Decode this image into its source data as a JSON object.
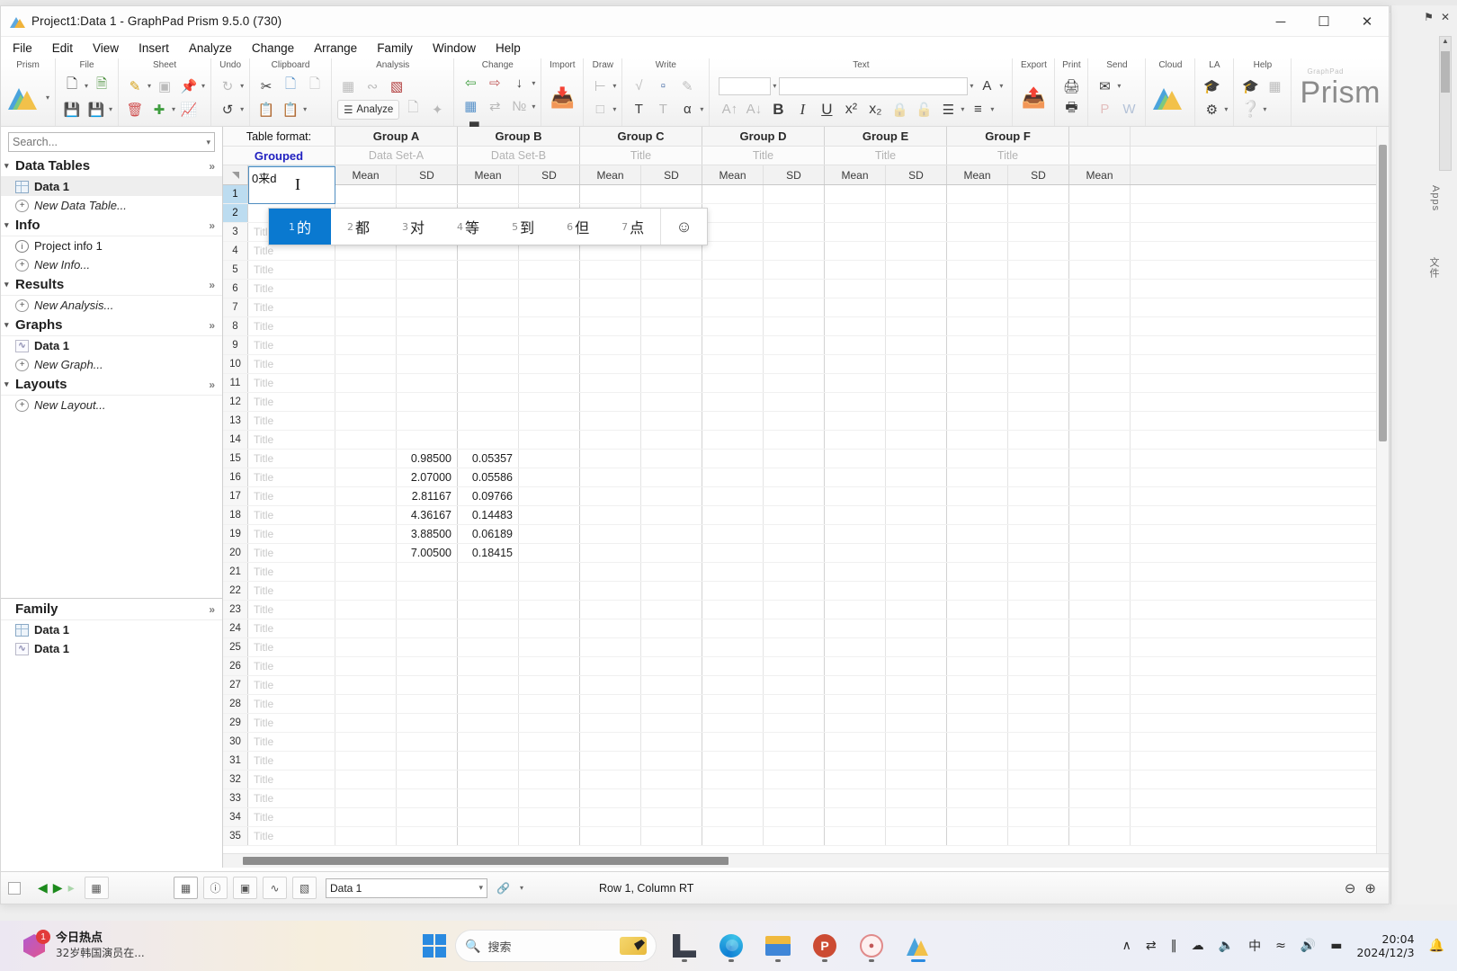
{
  "window": {
    "title": "Project1:Data 1 - GraphPad Prism 9.5.0 (730)",
    "minimize": "─",
    "maximize": "☐",
    "close": "✕"
  },
  "menu": {
    "items": [
      "File",
      "Edit",
      "View",
      "Insert",
      "Analyze",
      "Change",
      "Arrange",
      "Family",
      "Window",
      "Help"
    ]
  },
  "ribbon": {
    "groups": [
      {
        "label": "Prism"
      },
      {
        "label": "File"
      },
      {
        "label": "Sheet"
      },
      {
        "label": "Undo"
      },
      {
        "label": "Clipboard"
      },
      {
        "label": "Analysis"
      },
      {
        "label": "Change"
      },
      {
        "label": "Import"
      },
      {
        "label": "Draw"
      },
      {
        "label": "Write"
      },
      {
        "label": "Text"
      },
      {
        "label": "Export"
      },
      {
        "label": "Print"
      },
      {
        "label": "Send"
      },
      {
        "label": "Cloud"
      },
      {
        "label": "LA"
      },
      {
        "label": "Help"
      }
    ],
    "analyze_label": "Analyze",
    "font_size_value": "",
    "font_name_value": "",
    "brand": "Prism",
    "brand_tiny": "GraphPad"
  },
  "navigator": {
    "search_placeholder": "Search...",
    "sections": [
      {
        "title": "Data Tables",
        "expand": "»",
        "items": [
          {
            "label": "Data 1",
            "icon": "table-icon",
            "style": "bold",
            "selected": true
          },
          {
            "label": "New Data Table...",
            "icon": "plus-icon",
            "style": "italic",
            "selected": false
          }
        ]
      },
      {
        "title": "Info",
        "expand": "»",
        "items": [
          {
            "label": "Project info 1",
            "icon": "info-icon",
            "style": "normal",
            "selected": false
          },
          {
            "label": "New Info...",
            "icon": "plus-icon",
            "style": "italic",
            "selected": false
          }
        ]
      },
      {
        "title": "Results",
        "expand": "»",
        "items": [
          {
            "label": "New Analysis...",
            "icon": "plus-icon",
            "style": "italic",
            "selected": false
          }
        ]
      },
      {
        "title": "Graphs",
        "expand": "»",
        "items": [
          {
            "label": "Data 1",
            "icon": "graph-icon",
            "style": "bold",
            "selected": false
          },
          {
            "label": "New Graph...",
            "icon": "plus-icon",
            "style": "italic",
            "selected": false
          }
        ]
      },
      {
        "title": "Layouts",
        "expand": "»",
        "items": [
          {
            "label": "New Layout...",
            "icon": "plus-icon",
            "style": "italic",
            "selected": false
          }
        ]
      }
    ],
    "family": {
      "title": "Family",
      "expand": "»",
      "items": [
        {
          "label": "Data 1",
          "icon": "table-icon",
          "style": "bold"
        },
        {
          "label": "Data 1",
          "icon": "graph-icon",
          "style": "bold"
        }
      ]
    }
  },
  "sheet": {
    "format_label": "Table format:",
    "format_value": "Grouped",
    "close_col": "✕",
    "groups": [
      {
        "name": "Group A",
        "subtitle": "Data Set-A"
      },
      {
        "name": "Group B",
        "subtitle": "Data Set-B"
      },
      {
        "name": "Group C",
        "subtitle": "Title"
      },
      {
        "name": "Group D",
        "subtitle": "Title"
      },
      {
        "name": "Group E",
        "subtitle": "Title"
      },
      {
        "name": "Group F",
        "subtitle": "Title"
      }
    ],
    "subcolumns": [
      "Mean",
      "SD"
    ],
    "partial_subcolumn": "Mean",
    "row_title_placeholder": "Title",
    "editing_cell_text": "0来d",
    "rows": [
      {
        "n": "1",
        "title": "",
        "a_mean": "",
        "a_sd": "",
        "b_mean": "",
        "b_sd": ""
      },
      {
        "n": "2",
        "title": "",
        "a_mean": "",
        "a_sd": "",
        "b_mean": "",
        "b_sd": ""
      },
      {
        "n": "3",
        "title": "Title",
        "a_mean": "",
        "a_sd": "",
        "b_mean": "",
        "b_sd": ""
      },
      {
        "n": "4",
        "title": "Title",
        "a_mean": "",
        "a_sd": "",
        "b_mean": "",
        "b_sd": ""
      },
      {
        "n": "5",
        "title": "Title",
        "a_mean": "",
        "a_sd": "",
        "b_mean": "",
        "b_sd": ""
      },
      {
        "n": "6",
        "title": "Title",
        "a_mean": "",
        "a_sd": "",
        "b_mean": "",
        "b_sd": ""
      },
      {
        "n": "7",
        "title": "Title",
        "a_mean": "",
        "a_sd": "",
        "b_mean": "",
        "b_sd": ""
      },
      {
        "n": "8",
        "title": "Title",
        "a_mean": "",
        "a_sd": "",
        "b_mean": "",
        "b_sd": ""
      },
      {
        "n": "9",
        "title": "Title",
        "a_mean": "",
        "a_sd": "",
        "b_mean": "",
        "b_sd": ""
      },
      {
        "n": "10",
        "title": "Title",
        "a_mean": "",
        "a_sd": "",
        "b_mean": "",
        "b_sd": ""
      },
      {
        "n": "11",
        "title": "Title",
        "a_mean": "",
        "a_sd": "",
        "b_mean": "",
        "b_sd": ""
      },
      {
        "n": "12",
        "title": "Title",
        "a_mean": "",
        "a_sd": "",
        "b_mean": "",
        "b_sd": ""
      },
      {
        "n": "13",
        "title": "Title",
        "a_mean": "",
        "a_sd": "",
        "b_mean": "",
        "b_sd": ""
      },
      {
        "n": "14",
        "title": "Title",
        "a_mean": "",
        "a_sd": "",
        "b_mean": "",
        "b_sd": ""
      },
      {
        "n": "15",
        "title": "Title",
        "a_mean": "",
        "a_sd": "0.98500",
        "b_mean": "0.05357",
        "b_sd": ""
      },
      {
        "n": "16",
        "title": "Title",
        "a_mean": "",
        "a_sd": "2.07000",
        "b_mean": "0.05586",
        "b_sd": ""
      },
      {
        "n": "17",
        "title": "Title",
        "a_mean": "",
        "a_sd": "2.81167",
        "b_mean": "0.09766",
        "b_sd": ""
      },
      {
        "n": "18",
        "title": "Title",
        "a_mean": "",
        "a_sd": "4.36167",
        "b_mean": "0.14483",
        "b_sd": ""
      },
      {
        "n": "19",
        "title": "Title",
        "a_mean": "",
        "a_sd": "3.88500",
        "b_mean": "0.06189",
        "b_sd": ""
      },
      {
        "n": "20",
        "title": "Title",
        "a_mean": "",
        "a_sd": "7.00500",
        "b_mean": "0.18415",
        "b_sd": ""
      },
      {
        "n": "21",
        "title": "Title",
        "a_mean": "",
        "a_sd": "",
        "b_mean": "",
        "b_sd": ""
      },
      {
        "n": "22",
        "title": "Title",
        "a_mean": "",
        "a_sd": "",
        "b_mean": "",
        "b_sd": ""
      },
      {
        "n": "23",
        "title": "Title",
        "a_mean": "",
        "a_sd": "",
        "b_mean": "",
        "b_sd": ""
      },
      {
        "n": "24",
        "title": "Title",
        "a_mean": "",
        "a_sd": "",
        "b_mean": "",
        "b_sd": ""
      },
      {
        "n": "25",
        "title": "Title",
        "a_mean": "",
        "a_sd": "",
        "b_mean": "",
        "b_sd": ""
      },
      {
        "n": "26",
        "title": "Title",
        "a_mean": "",
        "a_sd": "",
        "b_mean": "",
        "b_sd": ""
      },
      {
        "n": "27",
        "title": "Title",
        "a_mean": "",
        "a_sd": "",
        "b_mean": "",
        "b_sd": ""
      },
      {
        "n": "28",
        "title": "Title",
        "a_mean": "",
        "a_sd": "",
        "b_mean": "",
        "b_sd": ""
      },
      {
        "n": "29",
        "title": "Title",
        "a_mean": "",
        "a_sd": "",
        "b_mean": "",
        "b_sd": ""
      },
      {
        "n": "30",
        "title": "Title",
        "a_mean": "",
        "a_sd": "",
        "b_mean": "",
        "b_sd": ""
      },
      {
        "n": "31",
        "title": "Title",
        "a_mean": "",
        "a_sd": "",
        "b_mean": "",
        "b_sd": ""
      },
      {
        "n": "32",
        "title": "Title",
        "a_mean": "",
        "a_sd": "",
        "b_mean": "",
        "b_sd": ""
      },
      {
        "n": "33",
        "title": "Title",
        "a_mean": "",
        "a_sd": "",
        "b_mean": "",
        "b_sd": ""
      },
      {
        "n": "34",
        "title": "Title",
        "a_mean": "",
        "a_sd": "",
        "b_mean": "",
        "b_sd": ""
      },
      {
        "n": "35",
        "title": "Title",
        "a_mean": "",
        "a_sd": "",
        "b_mean": "",
        "b_sd": ""
      }
    ]
  },
  "ime": {
    "candidates": [
      {
        "num": "1",
        "text": "的",
        "active": true
      },
      {
        "num": "2",
        "text": "都",
        "active": false
      },
      {
        "num": "3",
        "text": "对",
        "active": false
      },
      {
        "num": "4",
        "text": "等",
        "active": false
      },
      {
        "num": "5",
        "text": "到",
        "active": false
      },
      {
        "num": "6",
        "text": "但",
        "active": false
      },
      {
        "num": "7",
        "text": "点",
        "active": false
      }
    ],
    "emoji": "☺"
  },
  "statusbar": {
    "prev": "◀",
    "next": "▶",
    "sheet_select_value": "Data 1",
    "position": "Row 1, Column RT",
    "zoom_out": "⊖",
    "zoom_in": "⊕"
  },
  "right_strip": {
    "pin": "⚑",
    "close": "✕",
    "label_top": "Apps",
    "label_bottom": "文件"
  },
  "taskbar": {
    "news_title": "今日热点",
    "news_sub": "32岁韩国演员在...",
    "news_badge": "1",
    "search_placeholder": "搜索",
    "tray": [
      "∧",
      "⇄",
      "‖",
      "☁",
      "ᵀ",
      "中",
      "≈",
      "◁",
      "▬"
    ],
    "time": "20:04",
    "date": "2024/12/3"
  }
}
